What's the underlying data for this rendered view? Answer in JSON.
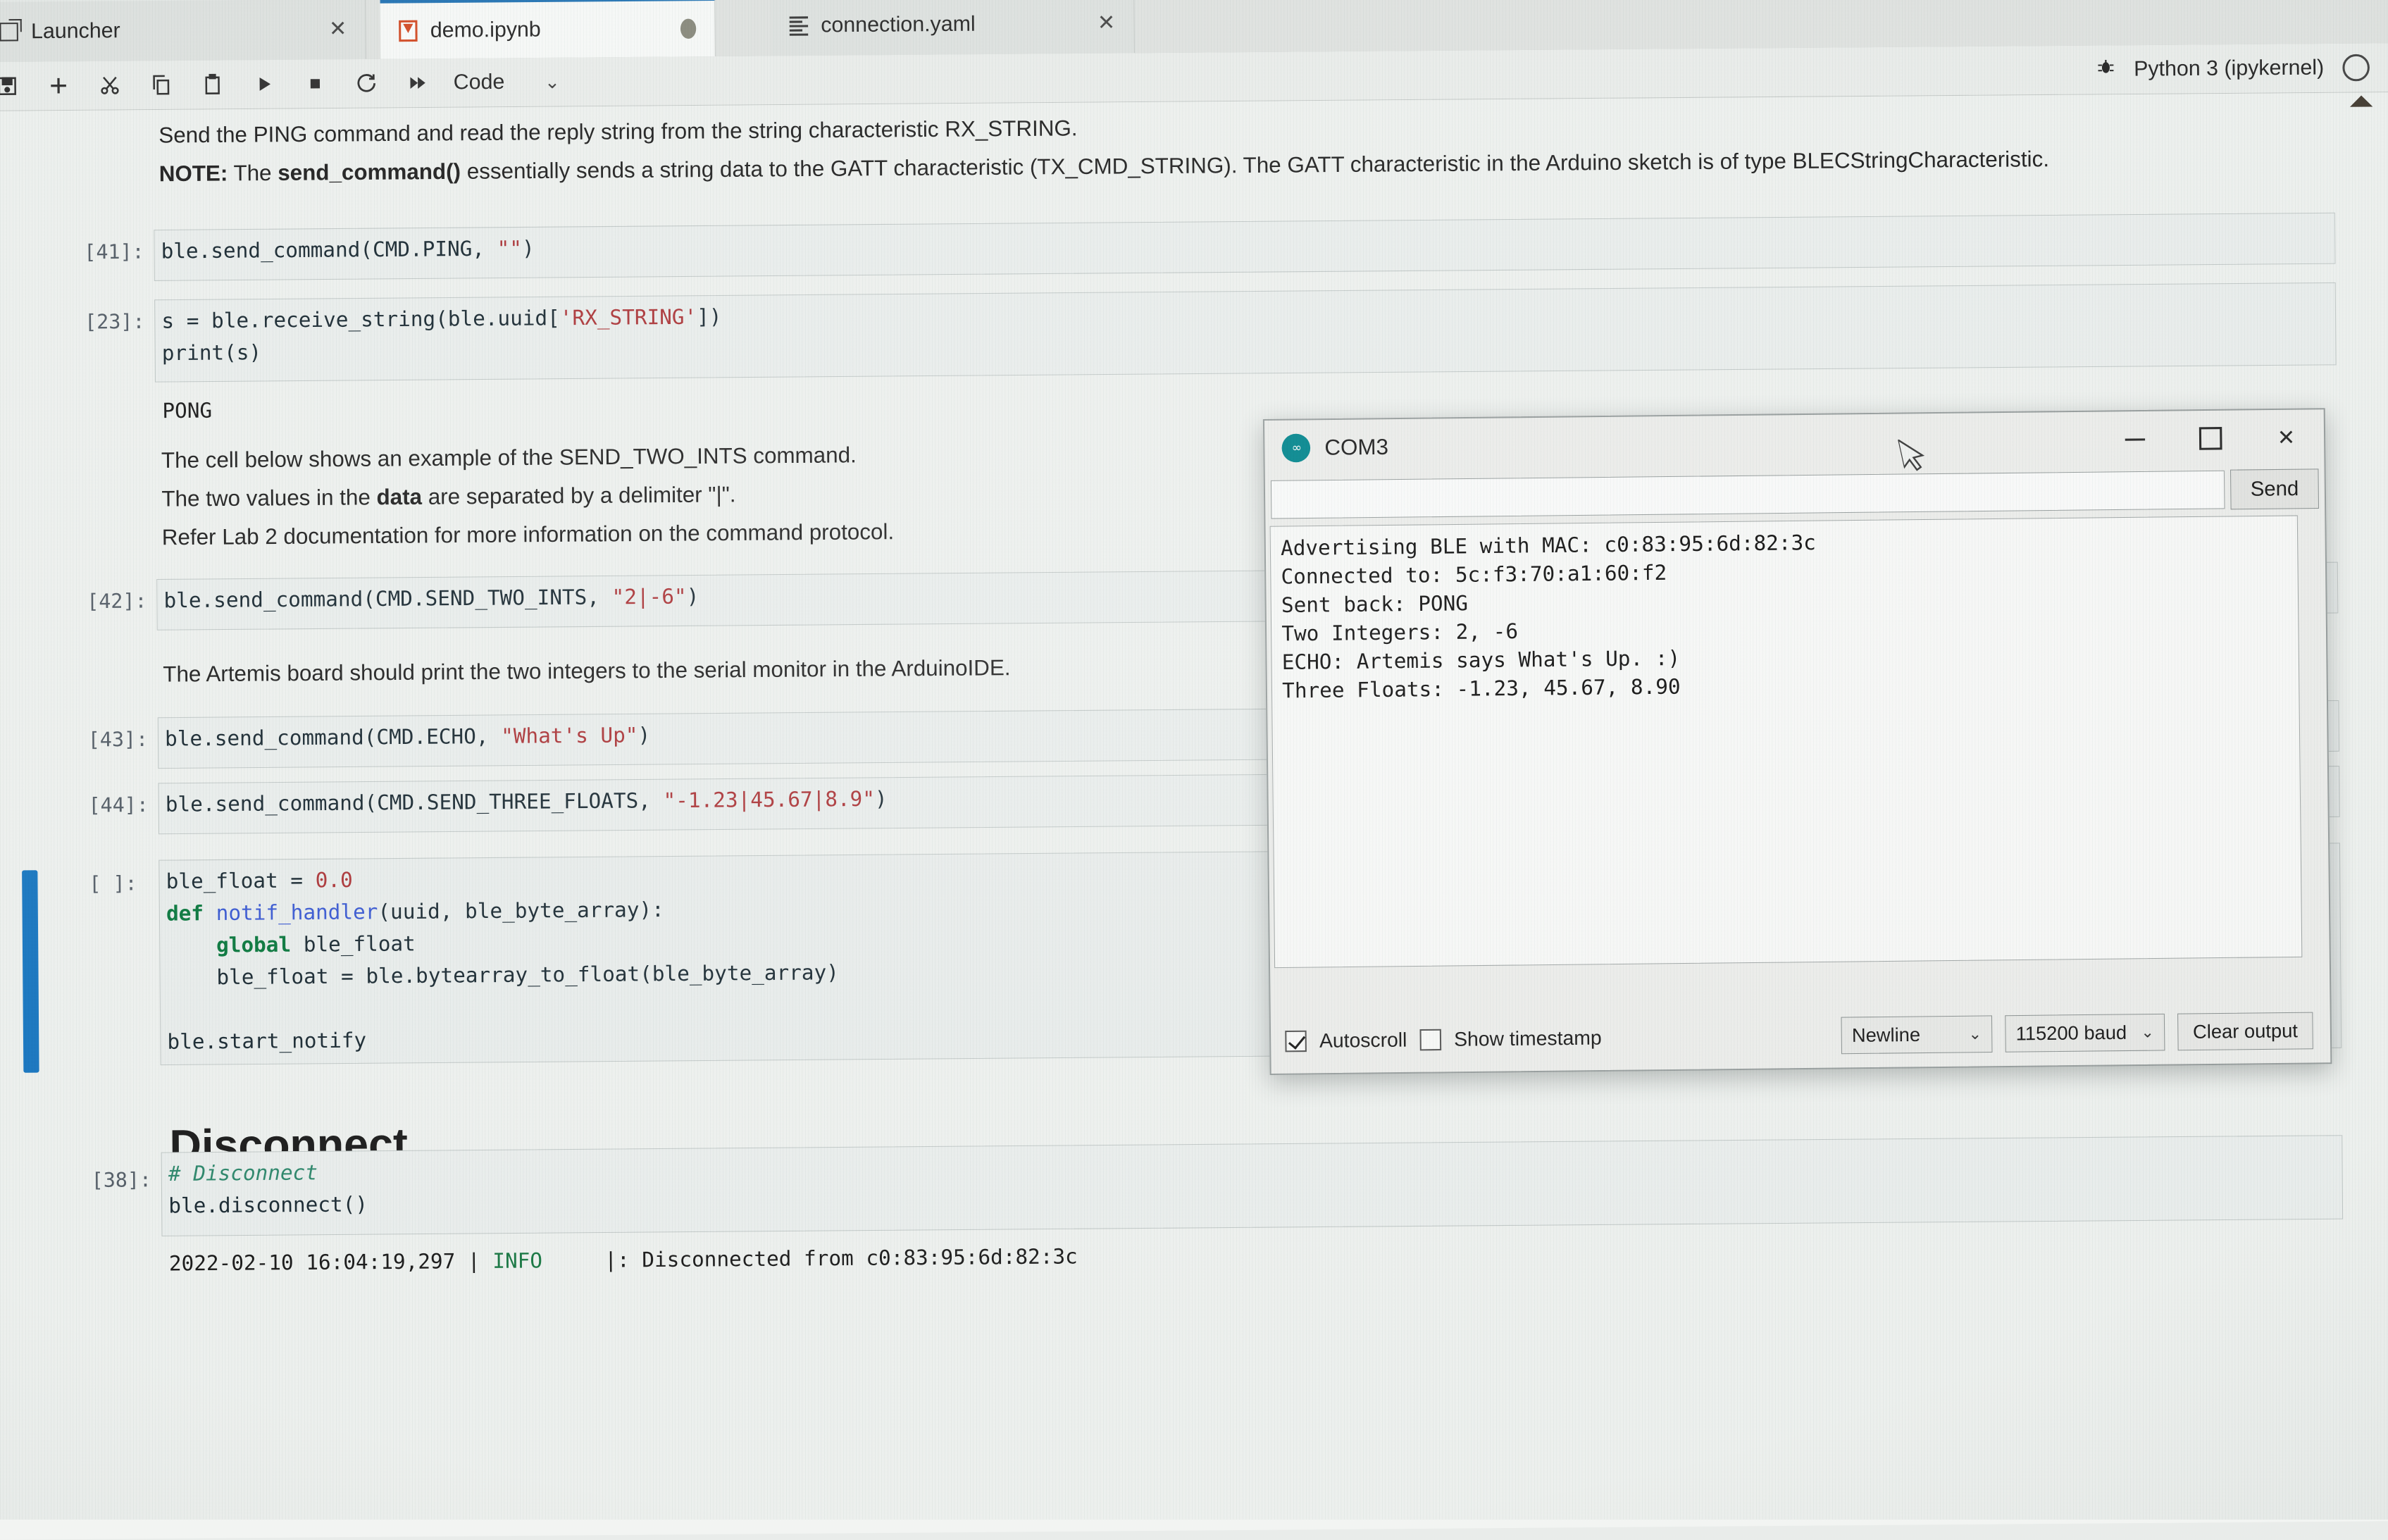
{
  "tabs": [
    {
      "label": "Launcher",
      "icon": "launcher-icon",
      "close": "✕",
      "state": "inactive"
    },
    {
      "label": "demo.ipynb",
      "icon": "notebook-icon",
      "dot": "modified-dot",
      "state": "active"
    },
    {
      "label": "connection.yaml",
      "icon": "yaml-file-icon",
      "close": "✕",
      "state": "inactive"
    }
  ],
  "toolbar": {
    "icons": [
      "save-icon",
      "add-cell-icon",
      "cut-icon",
      "copy-icon",
      "paste-icon",
      "run-icon",
      "stop-icon",
      "restart-icon",
      "run-all-icon"
    ],
    "cell_type": "Code",
    "chevron": "⌄",
    "kernel_name": "Python 3 (ipykernel)",
    "bug_icon": "bug-icon",
    "kernel_status_icon": "kernel-idle-circle"
  },
  "notebook": {
    "markdown_1_line_1": "Send the PING command and read the reply string from the string characteristic RX_STRING.",
    "markdown_1_note_prefix": "NOTE:",
    "markdown_1_note_a": " The ",
    "markdown_1_note_bold": "send_command()",
    "markdown_1_note_b": " essentially sends a string data to the GATT characteristic (TX_CMD_STRING). The GATT characteristic in the Arduino sketch is of type BLECStringCharacteristic.",
    "cell_41_prompt": "[41]:",
    "cell_41_code_a": "ble.send_command(CMD.PING, ",
    "cell_41_code_str": "\"\"",
    "cell_41_code_b": ")",
    "cell_23_prompt": "[23]:",
    "cell_23_line1_a": "s = ble.receive_string(ble.uuid[",
    "cell_23_line1_str": "'RX_STRING'",
    "cell_23_line1_b": "])",
    "cell_23_line2": "print(s)",
    "cell_23_output": "PONG",
    "markdown_2_line_1": "The cell below shows an example of the SEND_TWO_INTS command.",
    "markdown_2_line_2_a": "The two values in the ",
    "markdown_2_line_2_bold": "data",
    "markdown_2_line_2_b": " are separated by a delimiter \"|\".",
    "markdown_2_line_3": "Refer Lab 2 documentation for more information on the command protocol.",
    "cell_42_prompt": "[42]:",
    "cell_42_code_a": "ble.send_command(CMD.SEND_TWO_INTS, ",
    "cell_42_code_str": "\"2|-6\"",
    "cell_42_code_b": ")",
    "markdown_3_line_1": "The Artemis board should print the two integers to the serial monitor in the ArduinoIDE.",
    "cell_43_prompt": "[43]:",
    "cell_43_code_a": "ble.send_command(CMD.ECHO, ",
    "cell_43_code_str": "\"What's Up\"",
    "cell_43_code_b": ")",
    "cell_44_prompt": "[44]:",
    "cell_44_code_a": "ble.send_command(CMD.SEND_THREE_FLOATS, ",
    "cell_44_code_str": "\"-1.23|45.67|8.9\"",
    "cell_44_code_b": ")",
    "cell_empty_prompt": "[ ]:",
    "cell_empty_l1_a": "ble_float = ",
    "cell_empty_l1_num": "0.0",
    "cell_empty_l2_kw": "def",
    "cell_empty_l2_fn": " notif_handler",
    "cell_empty_l2_rest": "(uuid, ble_byte_array):",
    "cell_empty_l3_kw": "    global",
    "cell_empty_l3_rest": " ble_float",
    "cell_empty_l4": "    ble_float = ble.bytearray_to_float(ble_byte_array)",
    "cell_empty_l5": "",
    "cell_empty_l6": "ble.start_notify",
    "heading_disconnect": "Disconnect",
    "cell_38_prompt": "[38]:",
    "cell_38_comment": "# Disconnect",
    "cell_38_code": "ble.disconnect()",
    "cell_38_log_time": "2022-02-10 16:04:19,297",
    "cell_38_log_pipe1": " | ",
    "cell_38_log_level": "INFO",
    "cell_38_log_rest": "     |: Disconnected from c0:83:95:6d:82:3c",
    "scroll_up_arrow": "scroll-up-arrow"
  },
  "serial_monitor": {
    "title": "COM3",
    "logo": "arduino-logo-icon",
    "minimize": "minimize-icon",
    "maximize": "maximize-icon",
    "close": "close-icon",
    "input_value": "",
    "input_placeholder": "",
    "send_label": "Send",
    "output_lines": [
      "Advertising BLE with MAC: c0:83:95:6d:82:3c",
      "Connected to: 5c:f3:70:a1:60:f2",
      "Sent back: PONG",
      "Two Integers: 2, -6",
      "ECHO: Artemis says What's Up. :)",
      "Three Floats: -1.23, 45.67, 8.90"
    ],
    "autoscroll_label": "Autoscroll",
    "autoscroll_checked": true,
    "timestamp_label": "Show timestamp",
    "timestamp_checked": false,
    "line_ending": "Newline",
    "baud_rate": "115200 baud",
    "clear_label": "Clear output",
    "chevron": "⌄"
  },
  "colors": {
    "accent_blue": "#2878b8",
    "active_cell_bar": "#1a79c4",
    "arduino_teal": "#00878f",
    "notebook_orange": "#d8502a",
    "string_red": "#b0373a",
    "keyword_green": "#0a7a3f"
  }
}
